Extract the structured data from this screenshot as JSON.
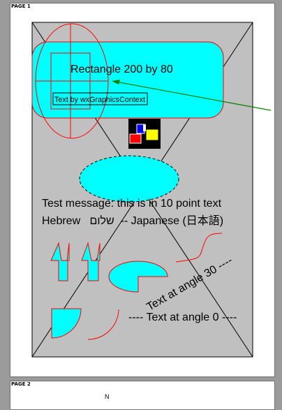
{
  "preview": {
    "page1_label": "PAGE 1",
    "page2_label": "PAGE 2",
    "page2_partial_text": "N"
  },
  "drawing": {
    "rect_label": "Rectangle 200 by 80",
    "gc_text": "Text by wxGraphicsContext",
    "test_message": "Test message: this is in 10 point text",
    "hebrew_line": "Hebrew   שלום  -- Japanese (日本語)",
    "angle30": "Text at angle 30 ----",
    "angle0": "---- Text at angle 0 ----"
  },
  "colors": {
    "page_bg": "#c0c0c0",
    "cyan": "#00ffff",
    "red": "#ff0000",
    "green": "#008000",
    "black": "#000000",
    "yellow": "#ffff00",
    "blue": "#0000ff"
  }
}
